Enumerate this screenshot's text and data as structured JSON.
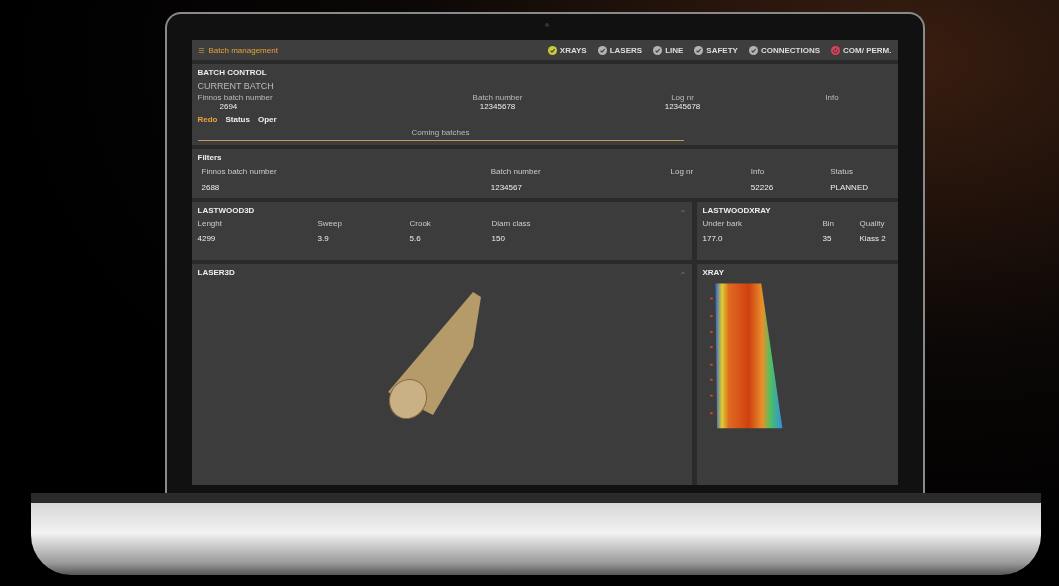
{
  "app_bar": {
    "title": "Batch management",
    "indicators": [
      {
        "label": "XRAYS",
        "kind": "check",
        "color": "#c8cc3a"
      },
      {
        "label": "LASERS",
        "kind": "check",
        "color": "#b4b4b4"
      },
      {
        "label": "LINE",
        "kind": "check",
        "color": "#b4b4b4"
      },
      {
        "label": "SAFETY",
        "kind": "check",
        "color": "#b4b4b4"
      },
      {
        "label": "CONNECTIONS",
        "kind": "check",
        "color": "#b4b4b4"
      },
      {
        "label": "COM/ PERM.",
        "kind": "power",
        "color": "#e0405a"
      }
    ]
  },
  "batch_control": {
    "heading": "BATCH CONTROL",
    "title": "CURRENT BATCH",
    "fields": [
      {
        "label": "Finnos batch number",
        "value": "2694"
      },
      {
        "label": "Batch number",
        "value": "12345678"
      },
      {
        "label": "Log nr",
        "value": "12345678"
      },
      {
        "label": "Info"
      }
    ],
    "tabs": [
      {
        "label": "Redo",
        "selected": true
      },
      {
        "label": "Status",
        "selected": false
      },
      {
        "label": "Oper",
        "selected": false
      }
    ],
    "coming_batches": "Coming batches"
  },
  "filters": {
    "heading": "Filters",
    "columns": [
      "Finnos batch number",
      "Batch number",
      "Log nr",
      "Info",
      "Status"
    ],
    "rows": [
      {
        "cells": [
          "2688",
          "1234567",
          null,
          "52226",
          "PLANNED"
        ]
      }
    ]
  },
  "lastwood3d": {
    "heading": "LASTWOOD3D",
    "columns": [
      "Lenght",
      "Sweep",
      "Crook",
      "Diam class"
    ],
    "values": [
      "4299",
      "3.9",
      "5.6",
      "150"
    ]
  },
  "lastwoodxray": {
    "heading": "LASTWOODXRAY",
    "columns": [
      "Under bark",
      "Bin",
      "Quality"
    ],
    "values": [
      "177.0",
      "35",
      "Klass 2"
    ]
  },
  "laser3d": {
    "heading": "LASER3D"
  },
  "xray": {
    "heading": "XRAY"
  }
}
